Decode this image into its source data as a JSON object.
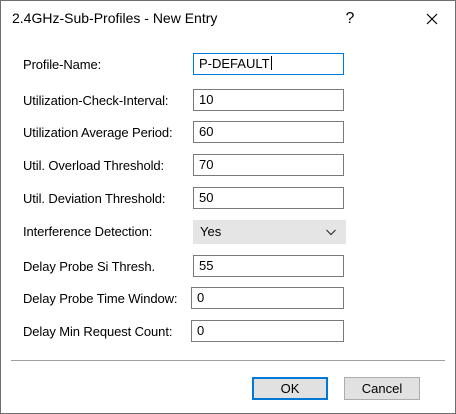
{
  "window": {
    "title": "2.4GHz-Sub-Profiles - New Entry",
    "help_label": "?",
    "close_icon": "close-icon"
  },
  "fields": [
    {
      "label": "Profile-Name:",
      "value": "P-DEFAULT",
      "type": "text",
      "focused": true
    },
    {
      "label": "Utilization-Check-Interval:",
      "value": "10",
      "type": "text"
    },
    {
      "label": "Utilization Average Period:",
      "value": "60",
      "type": "text"
    },
    {
      "label": "Util. Overload Threshold:",
      "value": "70",
      "type": "text"
    },
    {
      "label": "Util. Deviation Threshold:",
      "value": "50",
      "type": "text"
    },
    {
      "label": "Interference Detection:",
      "value": "Yes",
      "type": "select"
    },
    {
      "label": "Delay Probe Si Thresh.",
      "value": "55",
      "type": "text"
    },
    {
      "label": "Delay Probe Time Window:",
      "value": "0",
      "type": "text"
    },
    {
      "label": "Delay Min Request Count:",
      "value": "0",
      "type": "text"
    }
  ],
  "buttons": {
    "ok_label": "OK",
    "cancel_label": "Cancel"
  },
  "colors": {
    "focus_accent": "#0078d7",
    "button_face": "#e1e1e1",
    "select_face": "#e5e5e5"
  }
}
